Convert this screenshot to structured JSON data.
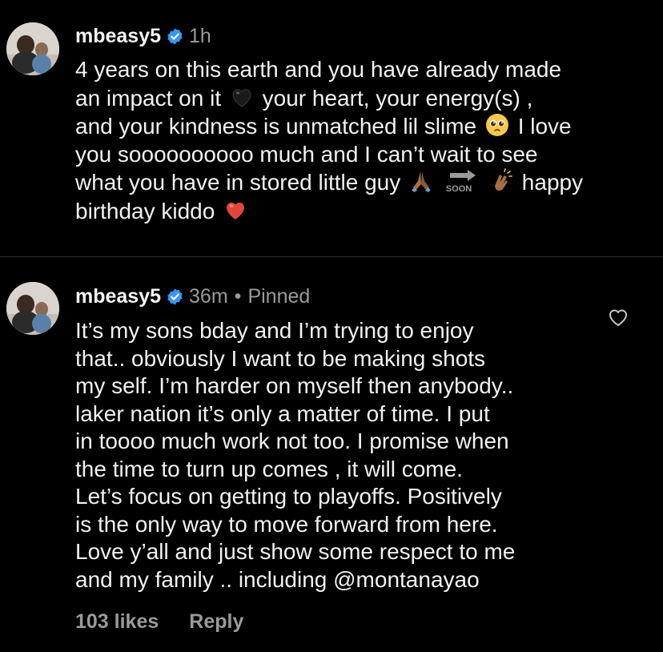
{
  "posts": [
    {
      "username": "mbeasy5",
      "time": "1h",
      "lines": [
        [
          "4 years on this earth and you have already made"
        ],
        [
          "an impact on it ",
          {
            "icon": "black-heart-icon"
          },
          " your heart, your energy(s) ,"
        ],
        [
          "and your kindness is unmatched lil slime ",
          {
            "icon": "pleading-face-icon"
          },
          " I love"
        ],
        [
          "you soooooooooo much and I can’t wait to see"
        ],
        [
          "what you have in stored little guy ",
          {
            "icon": "folded-hands-icon"
          },
          {
            "icon": "soon-arrow-icon",
            "text": "SOON"
          },
          {
            "icon": "clapping-hands-icon"
          },
          " happy"
        ],
        [
          "birthday kiddo ",
          {
            "icon": "red-heart-icon"
          }
        ]
      ]
    },
    {
      "username": "mbeasy5",
      "time": "36m",
      "dot": "•",
      "pinned": "Pinned",
      "lines": [
        [
          "It’s my sons bday and I’m trying to enjoy"
        ],
        [
          "that.. obviously I want to be making shots"
        ],
        [
          "my self. I’m harder on myself then anybody.."
        ],
        [
          "laker nation it’s only a matter of time. I put"
        ],
        [
          "in toooo much work not too. I promise when"
        ],
        [
          "the time to turn up comes , it will come."
        ],
        [
          "Let’s focus on getting to playoffs. Positively"
        ],
        [
          "is the only way to move forward from here."
        ],
        [
          "Love y’all and just show some respect to me"
        ],
        [
          "and my family .. including @montanayao"
        ]
      ],
      "likes": "103 likes",
      "reply": "Reply",
      "like_icon": "heart-outline-icon"
    }
  ],
  "colors": {
    "background": "#000000",
    "text": "#f2f2f2",
    "muted": "#9a9a9a",
    "verified": "#3897f0"
  }
}
